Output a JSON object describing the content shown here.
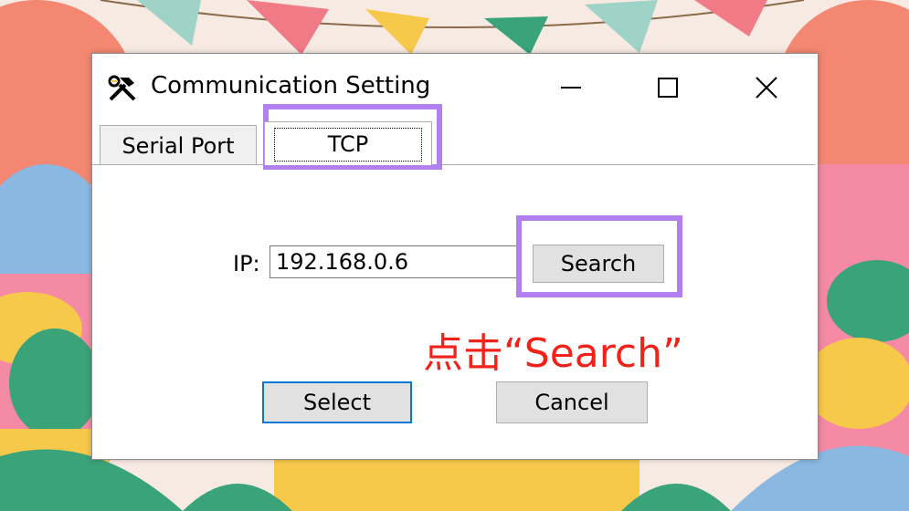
{
  "window": {
    "title": "Communication Setting",
    "controls": {
      "minimize": "—",
      "maximize": "☐",
      "close": "✕"
    }
  },
  "tabs": [
    {
      "label": "Serial Port",
      "selected": false
    },
    {
      "label": "TCP",
      "selected": true
    }
  ],
  "form": {
    "ip_label": "IP:",
    "ip_value": "192.168.0.6",
    "search_label": "Search",
    "select_label": "Select",
    "cancel_label": "Cancel"
  },
  "annotation": {
    "text": "点击“Search”",
    "color": "#f2221b"
  },
  "colors": {
    "highlight": "#b27ff0",
    "focus_border": "#0078d7"
  },
  "icons": {
    "app": "hammer-wrench-icon"
  }
}
